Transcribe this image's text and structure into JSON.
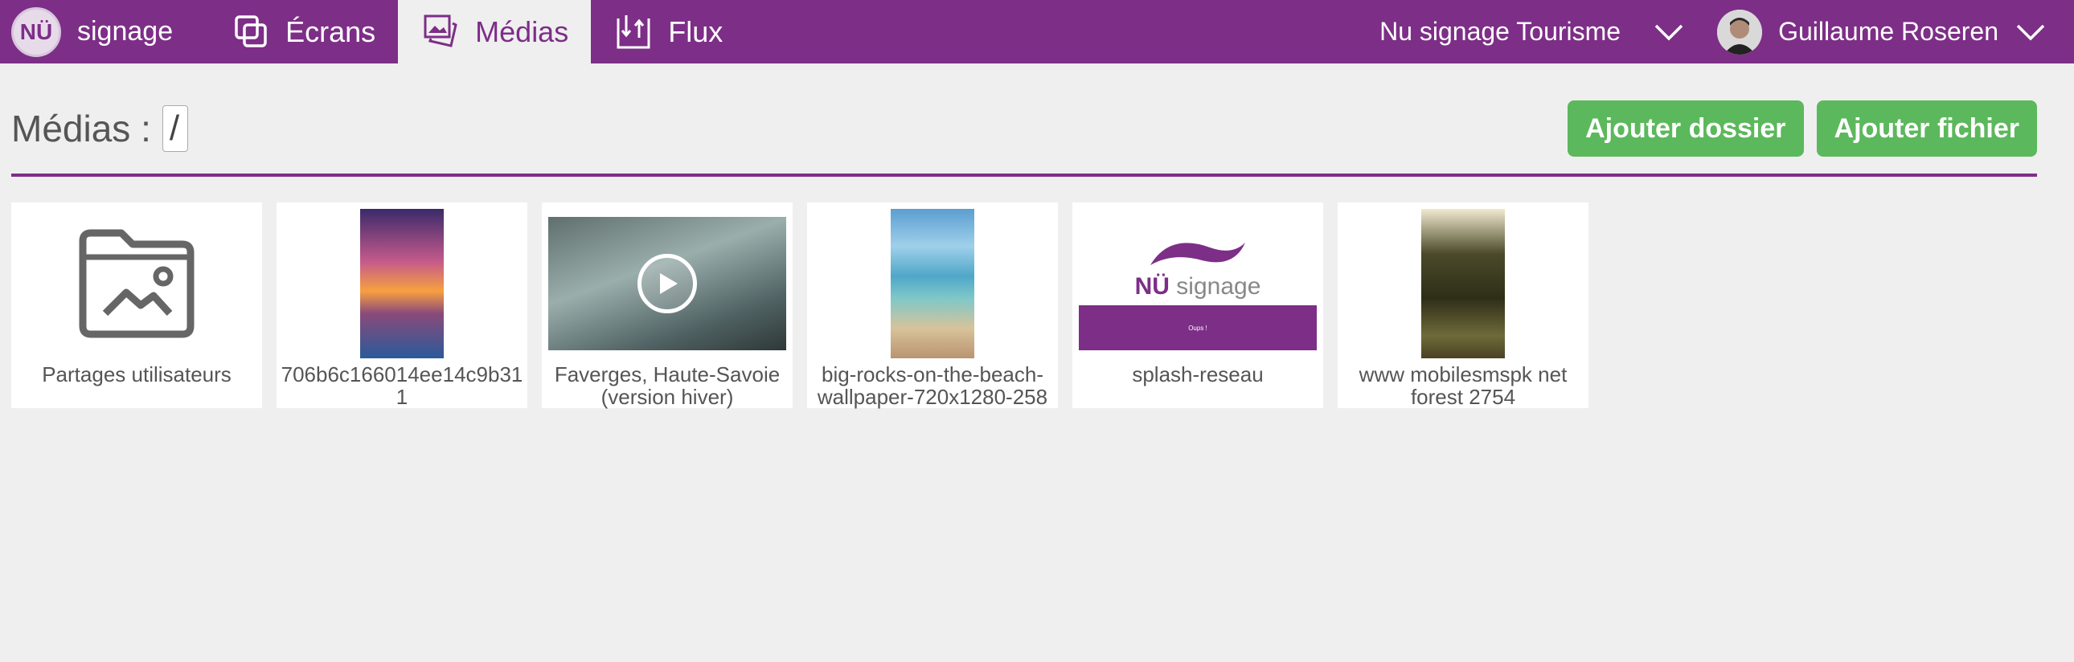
{
  "brand": {
    "logo_text": "NÜ",
    "name": "signage"
  },
  "nav": {
    "items": [
      {
        "label": "Écrans",
        "icon": "screens-icon"
      },
      {
        "label": "Médias",
        "icon": "media-icon",
        "active": true
      },
      {
        "label": "Flux",
        "icon": "flux-icon"
      }
    ]
  },
  "org": {
    "name": "Nu signage Tourisme"
  },
  "user": {
    "name": "Guillaume Roseren"
  },
  "page": {
    "title": "Médias :",
    "path": "/",
    "add_folder_label": "Ajouter dossier",
    "add_file_label": "Ajouter fichier"
  },
  "media": [
    {
      "label": "Partages utilisateurs",
      "type": "folder"
    },
    {
      "label": "706b6c166014ee14c9b311",
      "type": "image"
    },
    {
      "label": "Faverges, Haute-Savoie (version hiver)",
      "type": "video"
    },
    {
      "label": "big-rocks-on-the-beach-wallpaper-720x1280-258",
      "type": "image"
    },
    {
      "label": "splash-reseau",
      "type": "image"
    },
    {
      "label": "www mobilesmspk net forest 2754",
      "type": "image"
    }
  ],
  "splash": {
    "logo_main": "NÜ",
    "logo_rest": " signage",
    "band_text": "Oups !"
  },
  "colors": {
    "primary": "#7d2e87",
    "success": "#5cb85c",
    "background": "#efefef"
  }
}
